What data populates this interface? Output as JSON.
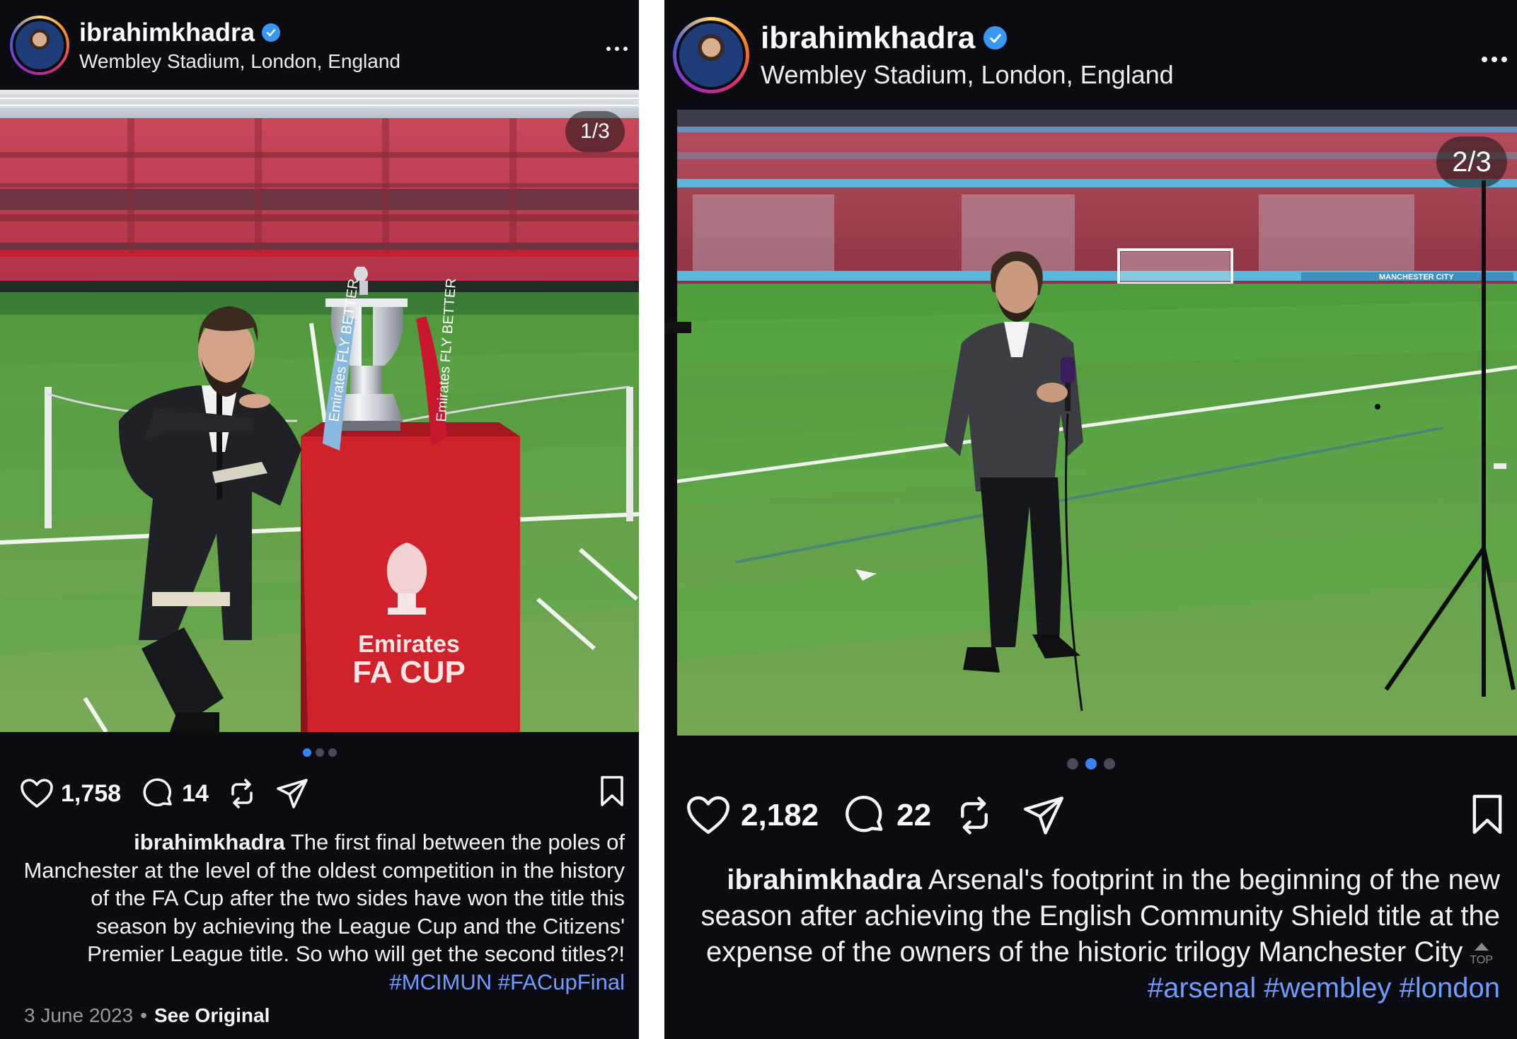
{
  "posts": [
    {
      "username": "ibrahimkhadra",
      "location": "Wembley Stadium, London, England",
      "counter": "1/3",
      "likes": "1,758",
      "comments": "14",
      "caption_user": "ibrahimkhadra",
      "caption_text": " The first final between the poles of Manchester at the level of the oldest competition in the history of the FA Cup after the two sides have won the title this season by achieving the League Cup and the Citizens' Premier League title. So who will get the second titles?! ",
      "tags": [
        "#MCIMUN",
        "#FACupFinal"
      ],
      "date": "3 June 2023",
      "see_original": "See Original",
      "carousel_index": 1,
      "carousel_total": 3,
      "photo_text": {
        "board_line1": "Emirates",
        "board_line2": "FA CUP",
        "ribbon_left": "Emirates FLY BETTER",
        "ribbon_right": "Emirates FLY BETTER"
      }
    },
    {
      "username": "ibrahimkhadra",
      "location": "Wembley Stadium, London, England",
      "counter": "2/3",
      "likes": "2,182",
      "comments": "22",
      "caption_user": "ibrahimkhadra",
      "caption_text": " Arsenal's footprint in the beginning of the new season after achieving the English Community Shield title at the expense of the owners of the historic trilogy Manchester City",
      "top_badge": "TOP",
      "tags": [
        "#arsenal",
        "#wembley",
        "#london"
      ],
      "carousel_index": 2,
      "carousel_total": 3,
      "photo_text": {
        "ad_board": "MANCHESTER CITY"
      }
    }
  ],
  "icons": [
    "verified-badge-icon",
    "more-options-icon",
    "heart-icon",
    "comment-icon",
    "repost-icon",
    "share-icon",
    "bookmark-icon",
    "scroll-top-icon"
  ],
  "colors": {
    "background": "#0b0b12",
    "hashtag": "#6f9dff",
    "verified": "#3897f0",
    "active_dot": "#3b82f6"
  }
}
